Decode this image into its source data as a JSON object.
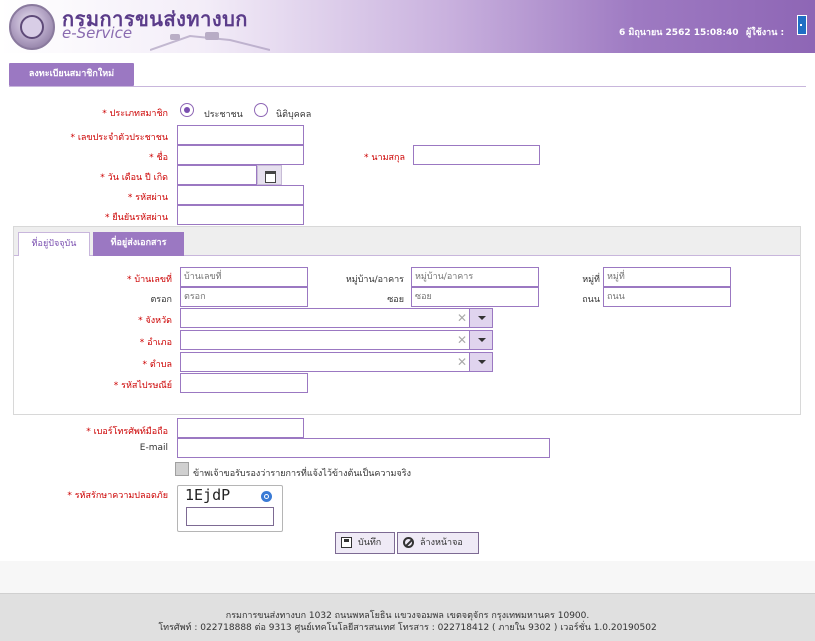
{
  "header": {
    "title_th": "กรมการขนส่งทางบก",
    "title_en": "e-Service",
    "datetime": "6 มิถุนายน 2562 15:08:40",
    "user_label": "ผู้ใช้งาน :"
  },
  "page": {
    "title": "ลงทะเบียนสมาชิกใหม่"
  },
  "form": {
    "member_type_label": "ประเภทสมาชิก",
    "member_type_options": [
      "ประชาชน",
      "นิติบุคคล"
    ],
    "member_type_selected": "ประชาชน",
    "id_card_label": "เลขประจำตัวประชาชน",
    "first_name_label": "ชื่อ",
    "last_name_label": "นามสกุล",
    "birthdate_label": "วัน เดือน ปี เกิด",
    "password_label": "รหัสผ่าน",
    "confirm_password_label": "ยืนยันรหัสผ่าน",
    "req_mark": "*"
  },
  "address": {
    "tabs": [
      "ที่อยู่ปัจจุบัน",
      "ที่อยู่ส่งเอกสาร"
    ],
    "active_tab": "ที่อยู่ส่งเอกสาร",
    "house_no_label": "บ้านเลขที่",
    "house_no_placeholder": "บ้านเลขที่",
    "village_label": "หมู่บ้าน/อาคาร",
    "village_placeholder": "หมู่บ้าน/อาคาร",
    "moo_label": "หมู่ที่",
    "moo_placeholder": "หมู่ที่",
    "trok_label": "ตรอก",
    "trok_placeholder": "ตรอก",
    "soi_label": "ซอย",
    "soi_placeholder": "ซอย",
    "road_label": "ถนน",
    "road_placeholder": "ถนน",
    "province_label": "จังหวัด",
    "district_label": "อำเภอ",
    "subdistrict_label": "ตำบล",
    "postcode_label": "รหัสไปรษณีย์"
  },
  "contact": {
    "mobile_label": "เบอร์โทรศัพท์มือถือ",
    "email_label": "E-mail",
    "consent_text": "ข้าพเจ้าขอรับรองว่ารายการที่แจ้งไว้ข้างต้นเป็นความจริง",
    "captcha_label": "รหัสรักษาความปลอดภัย",
    "captcha_code": "1EjdP"
  },
  "buttons": {
    "save": "บันทึก",
    "clear": "ล้างหน้าจอ"
  },
  "footer": {
    "line1": "กรมการขนส่งทางบก 1032 ถนนพหลโยธิน แขวงจอมพล เขตจตุจักร กรุงเทพมหานคร 10900.",
    "line2": "โทรศัพท์ : 022718888 ต่อ 9313 ศูนย์เทคโนโลยีสารสนเทศ โทรสาร : 022718412 ( ภายใน 9302 ) เวอร์ชั่น 1.0.20190502"
  },
  "colors": {
    "accent": "#9b78c2",
    "required": "#cc0000"
  }
}
